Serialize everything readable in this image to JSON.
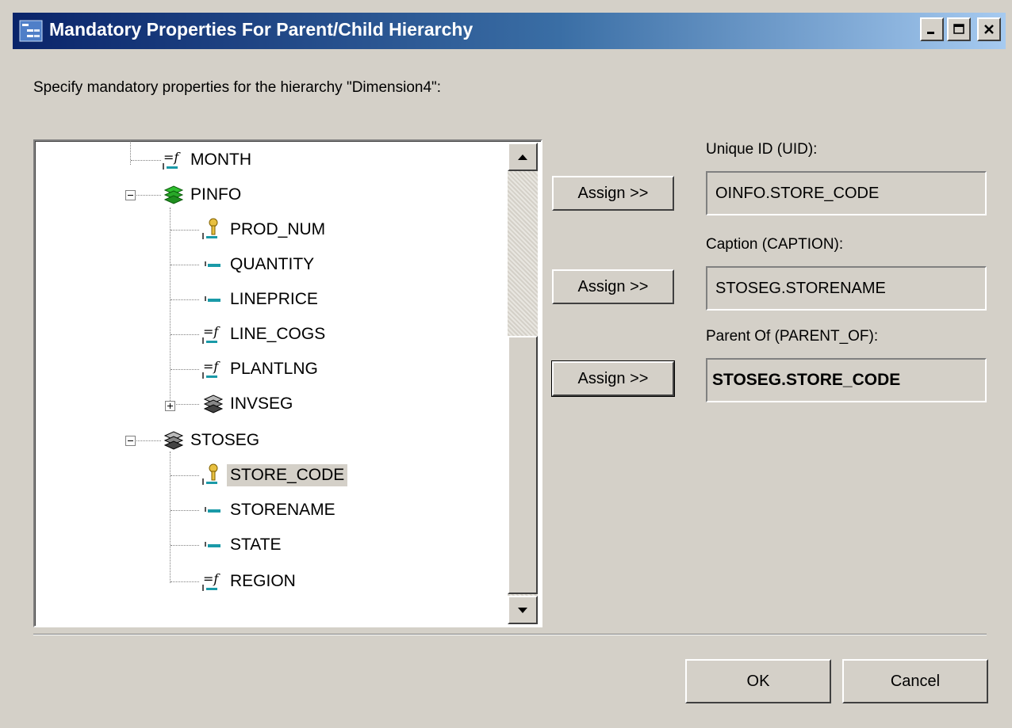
{
  "window": {
    "title": "Mandatory Properties For Parent/Child Hierarchy",
    "icon": "hierarchy-icon"
  },
  "prompt": "Specify mandatory properties for the hierarchy \"Dimension4\":",
  "tree": {
    "items": [
      {
        "label": "MONTH",
        "icon": "formula-field-icon"
      },
      {
        "label": "PINFO",
        "icon": "segment-green-icon",
        "expanded": true
      },
      {
        "label": "PROD_NUM",
        "icon": "key-field-icon"
      },
      {
        "label": "QUANTITY",
        "icon": "field-icon"
      },
      {
        "label": "LINEPRICE",
        "icon": "field-icon"
      },
      {
        "label": "LINE_COGS",
        "icon": "formula-field-icon"
      },
      {
        "label": "PLANTLNG",
        "icon": "formula-field-icon"
      },
      {
        "label": "INVSEG",
        "icon": "segment-icon",
        "expanded": false
      },
      {
        "label": "STOSEG",
        "icon": "segment-icon",
        "expanded": true
      },
      {
        "label": "STORE_CODE",
        "icon": "key-field-icon",
        "selected": true
      },
      {
        "label": "STORENAME",
        "icon": "field-icon"
      },
      {
        "label": "STATE",
        "icon": "field-icon"
      },
      {
        "label": "REGION",
        "icon": "formula-field-icon"
      }
    ]
  },
  "properties": {
    "uid": {
      "label": "Unique ID (UID):",
      "value": "OINFO.STORE_CODE",
      "button": "Assign >>"
    },
    "caption": {
      "label": "Caption (CAPTION):",
      "value": "STOSEG.STORENAME",
      "button": "Assign >>"
    },
    "parent_of": {
      "label": "Parent Of (PARENT_OF):",
      "value": "STOSEG.STORE_CODE",
      "button": "Assign >>"
    }
  },
  "buttons": {
    "ok": "OK",
    "cancel": "Cancel"
  },
  "colors": {
    "titlebar_start": "#0a246a",
    "titlebar_end": "#a6caf0",
    "dialog_bg": "#d4d0c8"
  }
}
